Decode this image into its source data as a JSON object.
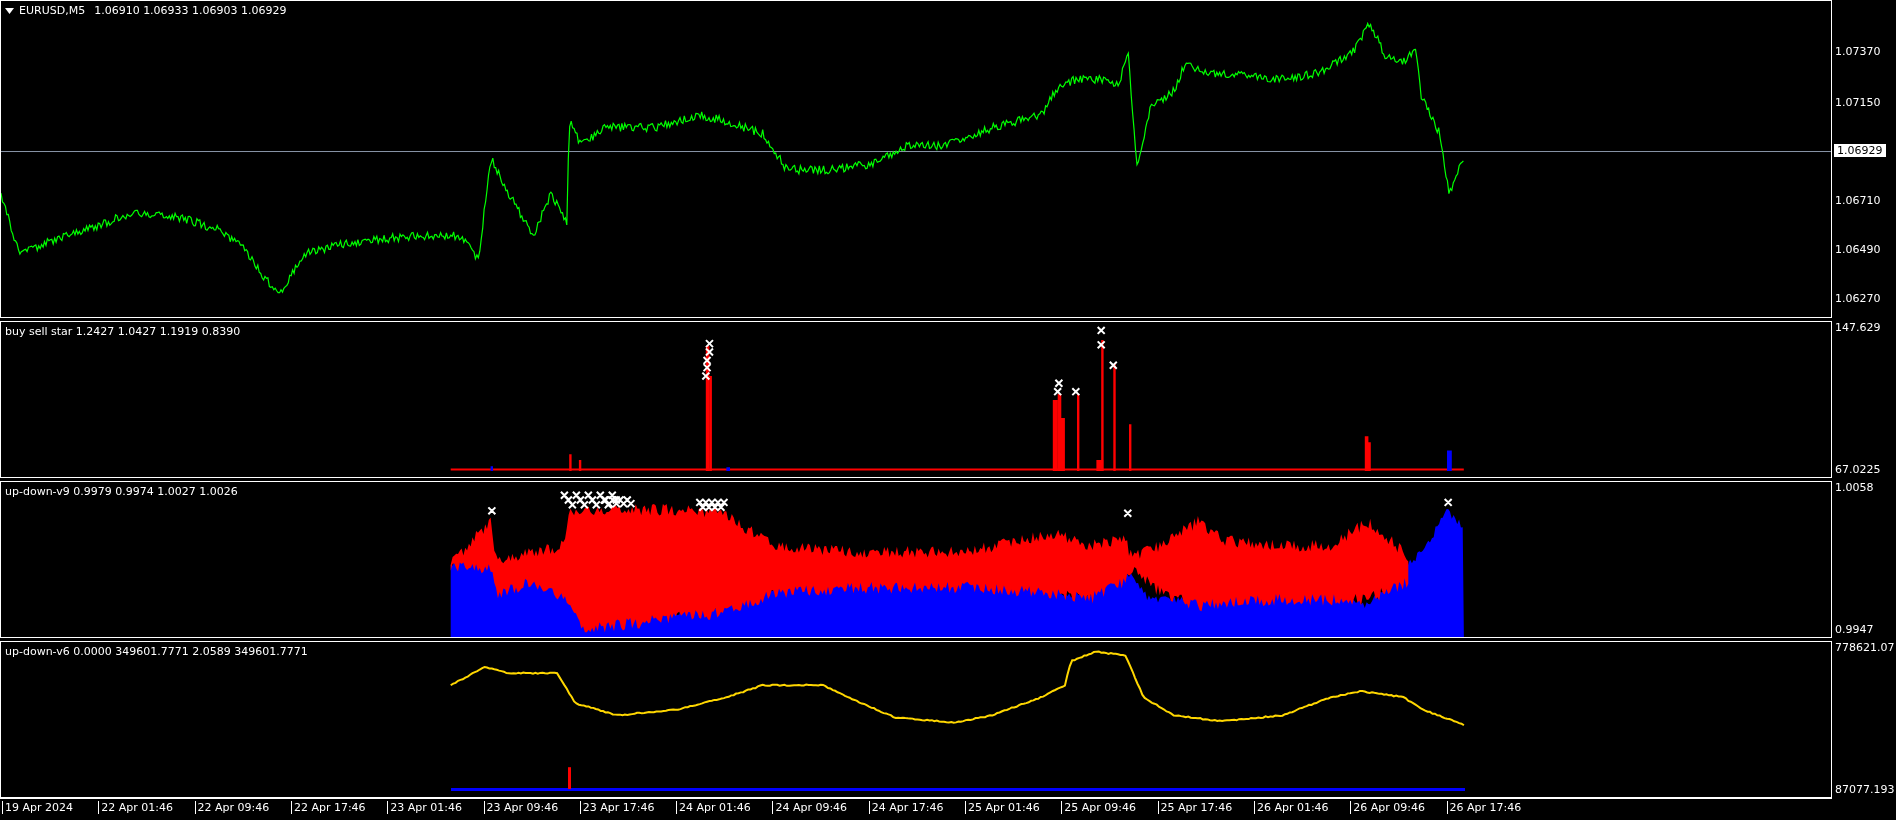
{
  "main_pane": {
    "symbol": "EURUSD,M5",
    "ohlc": "1.06910 1.06933 1.06903 1.06929",
    "axis_labels": [
      "1.07370",
      "1.07150",
      "1.06710",
      "1.06490",
      "1.06270"
    ],
    "current_price": "1.06929"
  },
  "indicators": [
    {
      "kind": "bars",
      "header": "buy sell star 1.2427 1.0427 1.1919 0.8390",
      "axis_labels": [
        "147.629",
        "67.0225"
      ]
    },
    {
      "kind": "area",
      "header": "up-down-v9 0.9979 0.9974 1.0027 1.0026",
      "axis_labels": [
        "1.0058",
        "0.9947"
      ]
    },
    {
      "kind": "line",
      "header": "up-down-v6 0.0000 349601.7771 2.0589 349601.7771",
      "axis_labels": [
        "778621.07",
        "87077.193"
      ]
    }
  ],
  "time_axis": [
    "19 Apr 2024",
    "22 Apr 01:46",
    "22 Apr 09:46",
    "22 Apr 17:46",
    "23 Apr 01:46",
    "23 Apr 09:46",
    "23 Apr 17:46",
    "24 Apr 01:46",
    "24 Apr 09:46",
    "24 Apr 17:46",
    "25 Apr 01:46",
    "25 Apr 09:46",
    "25 Apr 17:46",
    "26 Apr 01:46",
    "26 Apr 09:46",
    "26 Apr 17:46"
  ]
}
